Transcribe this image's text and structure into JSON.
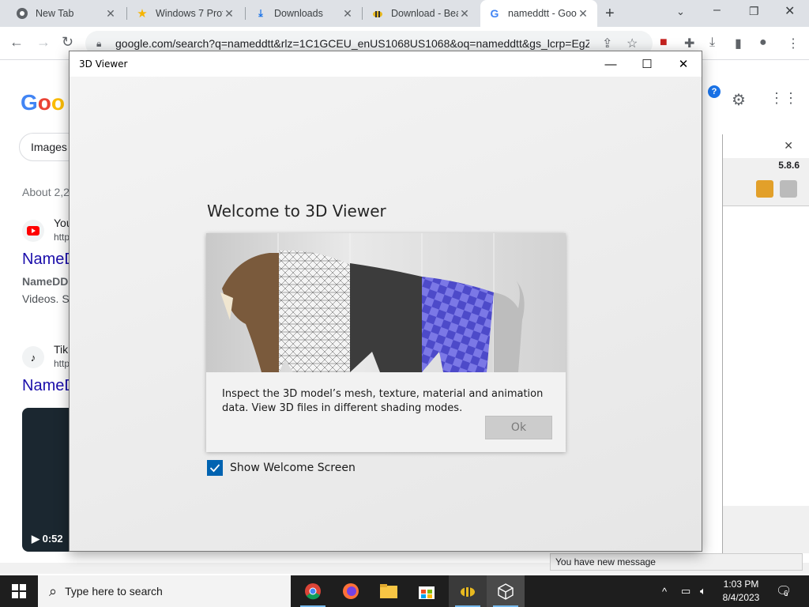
{
  "browser": {
    "tabs": [
      {
        "label": "New Tab"
      },
      {
        "label": "Windows 7 Prof"
      },
      {
        "label": "Downloads"
      },
      {
        "label": "Download - Bea"
      },
      {
        "label": "nameddtt - Goo"
      }
    ],
    "url": "google.com/search?q=nameddtt&rlz=1C1GCEU_enUS1068US1068&oq=nameddtt&gs_lcrp=EgZ..."
  },
  "google": {
    "chip_images": "Images",
    "about": "About 2,2",
    "result1": {
      "name": "You",
      "url": "http",
      "title": "NameD",
      "text1": "NameDD",
      "text2": "Videos. S"
    },
    "result2": {
      "name": "Tik",
      "url": "http",
      "title": "NameD"
    },
    "video_duration": "0:52"
  },
  "side_window": {
    "version": "5.8.6"
  },
  "message": "You have new message",
  "viewer": {
    "title": "3D Viewer",
    "heading": "Welcome to 3D Viewer",
    "description": "Inspect the 3D model’s mesh, texture, material and animation data. View 3D files in different shading modes.",
    "ok_label": "Ok",
    "show_welcome_label": "Show Welcome Screen",
    "show_welcome_checked": true
  },
  "taskbar": {
    "search_placeholder": "Type here to search",
    "time": "1:03 PM",
    "date": "8/4/2023",
    "notification_count": "6"
  },
  "colors": {
    "accent": "#0063b1",
    "taskbar": "#1e1e1e",
    "link": "#1a0dab"
  }
}
